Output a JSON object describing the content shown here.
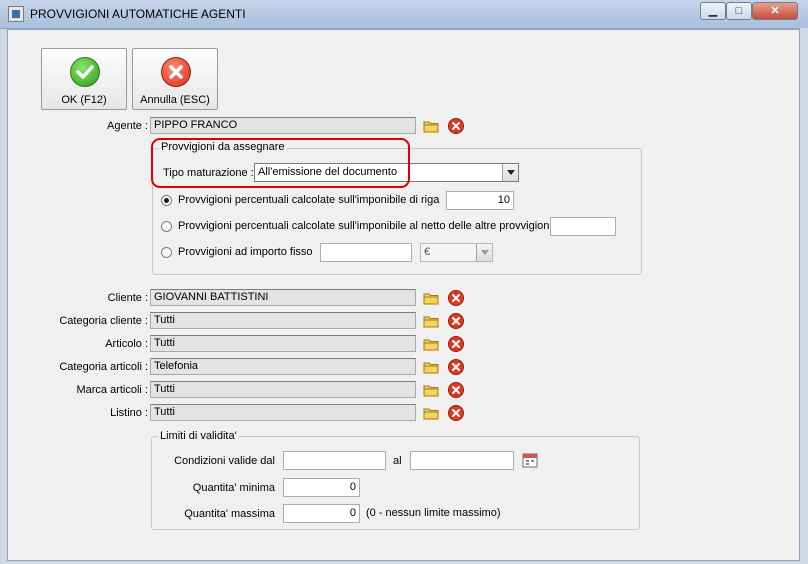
{
  "window": {
    "title": "PROVVIGIONI AUTOMATICHE AGENTI",
    "minimize_glyph": "▁",
    "maximize_glyph": "□",
    "close_glyph": "✕"
  },
  "toolbar": {
    "ok_label": "OK (F12)",
    "cancel_label": "Annulla (ESC)",
    "ok_icon": "check-icon",
    "cancel_icon": "cancel-icon"
  },
  "agent": {
    "label": "Agente :",
    "value": "PIPPO FRANCO"
  },
  "commission_group": {
    "title": "Provvigioni da assegnare",
    "maturation_label": "Tipo maturazione :",
    "maturation_value": "All'emissione del documento",
    "options": [
      {
        "label": "Provvigioni percentuali calcolate sull'imponibile di riga",
        "value": "10",
        "selected": true
      },
      {
        "label": "Provvigioni percentuali calcolate sull'imponibile al netto delle altre provvigioni",
        "value": "",
        "selected": false
      },
      {
        "label": "Provvigioni ad importo fisso",
        "value": "",
        "selected": false
      }
    ],
    "currency": "€"
  },
  "filters": [
    {
      "label": "Cliente :",
      "value": "GIOVANNI BATTISTINI"
    },
    {
      "label": "Categoria cliente :",
      "value": "Tutti"
    },
    {
      "label": "Articolo :",
      "value": "Tutti"
    },
    {
      "label": "Categoria articoli :",
      "value": "Telefonia"
    },
    {
      "label": "Marca articoli :",
      "value": "Tutti"
    },
    {
      "label": "Listino :",
      "value": "Tutti"
    }
  ],
  "validity": {
    "title": "Limiti di validita'",
    "valid_from_label": "Condizioni valide dal",
    "to_label": "al",
    "from_value": "",
    "to_value": "",
    "min_qty_label": "Quantita' minima",
    "min_qty_value": "0",
    "max_qty_label": "Quantita' massima",
    "max_qty_value": "0",
    "max_qty_note": "(0 - nessun limite massimo)"
  },
  "colors": {
    "highlight": "#e00000",
    "ok": "#2d9a1d",
    "cancel": "#d42a16"
  }
}
